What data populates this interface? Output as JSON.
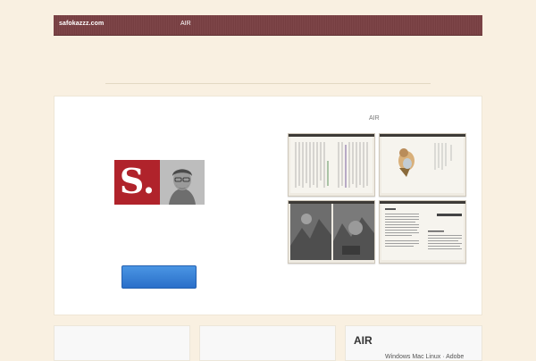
{
  "header": {
    "site_name": "safokazzz.com",
    "nav": [
      {
        "label": "AIR"
      }
    ],
    "bar_color": "#7a4043"
  },
  "hero": {
    "logo_letter": "S.",
    "logo_color": "#b0232b",
    "button_label": "",
    "button_color": "#2a6fc9",
    "gallery_title": "AIR",
    "gallery_items": [
      {
        "kind": "text-spread"
      },
      {
        "kind": "bird-illustration-spread"
      },
      {
        "kind": "photo-spread"
      },
      {
        "kind": "heading-text-spread"
      }
    ]
  },
  "bottom": {
    "cards": [
      {
        "title": ""
      },
      {
        "title": ""
      }
    ],
    "sidebar": {
      "title": "AIR",
      "text": "Windows Mac Linux · Adobe"
    }
  }
}
